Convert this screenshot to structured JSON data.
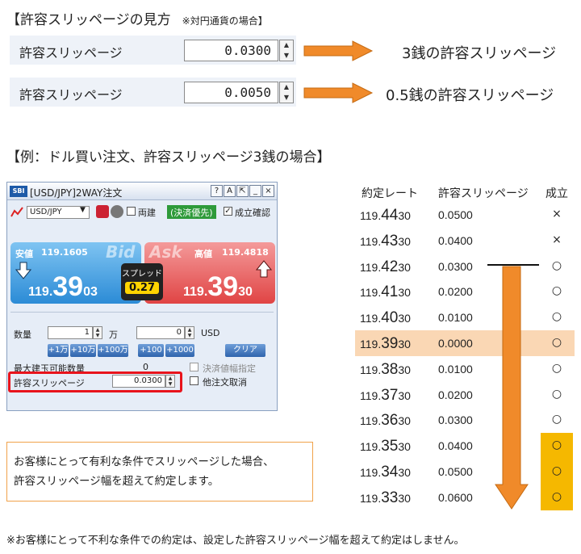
{
  "heading1": {
    "title": "【許容スリッページの見方",
    "note": "※対円通貨の場合】"
  },
  "slip_rows": [
    {
      "label": "許容スリッページ",
      "value": "0.0300",
      "desc": "3銭の許容スリッページ"
    },
    {
      "label": "許容スリッページ",
      "value": "0.0050",
      "desc": "0.5銭の許容スリッページ"
    }
  ],
  "heading2": "【例：ドル買い注文、許容スリッページ3銭の場合】",
  "window": {
    "logo": "SBI",
    "title": "[USD/JPY]2WAY注文",
    "title_buttons": [
      "?",
      "A",
      "⇱",
      "_",
      "×"
    ],
    "pair": "USD/JPY",
    "ryodate": "両建",
    "settle": "(決済優先)",
    "confirm": "成立確認",
    "bid_label": "安値",
    "bid_low": "119.1605",
    "bid_tag": "Bid",
    "bid_int": "119.",
    "bid_big": "39",
    "bid_small": "03",
    "ask_label": "高値",
    "ask_high": "119.4818",
    "ask_tag": "Ask",
    "ask_int": "119.",
    "ask_big": "39",
    "ask_small": "30",
    "spread_label": "スプレッド",
    "spread_value": "0.27",
    "qty_label": "数量",
    "qty_value": "1",
    "qty_unit": "万",
    "qty2_value": "0",
    "qty2_unit": "USD",
    "lot_buttons": [
      "+1万",
      "+10万",
      "+100万"
    ],
    "lot_buttons2": [
      "+100",
      "+1000"
    ],
    "clear": "クリア",
    "max_label": "最大建玉可能数量",
    "max_value": "0",
    "settle_price": "決済値幅指定",
    "cancel_other": "他注文取消",
    "slip_label": "許容スリッページ",
    "slip_value": "0.0300"
  },
  "table": {
    "headers": [
      "約定レート",
      "許容スリッページ",
      "成立"
    ],
    "rows": [
      {
        "rate_a": "119.",
        "rate_b": "44",
        "rate_c": "30",
        "slip": "0.0500",
        "mark": "×"
      },
      {
        "rate_a": "119.",
        "rate_b": "43",
        "rate_c": "30",
        "slip": "0.0400",
        "mark": "×"
      },
      {
        "rate_a": "119.",
        "rate_b": "42",
        "rate_c": "30",
        "slip": "0.0300",
        "mark": "○"
      },
      {
        "rate_a": "119.",
        "rate_b": "41",
        "rate_c": "30",
        "slip": "0.0200",
        "mark": "○"
      },
      {
        "rate_a": "119.",
        "rate_b": "40",
        "rate_c": "30",
        "slip": "0.0100",
        "mark": "○"
      },
      {
        "rate_a": "119.",
        "rate_b": "39",
        "rate_c": "30",
        "slip": "0.0000",
        "mark": "○"
      },
      {
        "rate_a": "119.",
        "rate_b": "38",
        "rate_c": "30",
        "slip": "0.0100",
        "mark": "○"
      },
      {
        "rate_a": "119.",
        "rate_b": "37",
        "rate_c": "30",
        "slip": "0.0200",
        "mark": "○"
      },
      {
        "rate_a": "119.",
        "rate_b": "36",
        "rate_c": "30",
        "slip": "0.0300",
        "mark": "○"
      },
      {
        "rate_a": "119.",
        "rate_b": "35",
        "rate_c": "30",
        "slip": "0.0400",
        "mark": "○"
      },
      {
        "rate_a": "119.",
        "rate_b": "34",
        "rate_c": "30",
        "slip": "0.0500",
        "mark": "○"
      },
      {
        "rate_a": "119.",
        "rate_b": "33",
        "rate_c": "30",
        "slip": "0.0600",
        "mark": "○"
      }
    ]
  },
  "note": {
    "line1": "お客様にとって有利な条件でスリッページした場合、",
    "line2": "許容スリッページ幅を超えて約定します。"
  },
  "footnote": "※お客様にとって不利な条件での約定は、設定した許容スリッページ幅を超えて約定はしません。",
  "colors": {
    "arrow": "#f08a2a",
    "highlight_row": "#fad7b4",
    "favorable": "#f5b800",
    "red_frame": "#e8141c"
  }
}
